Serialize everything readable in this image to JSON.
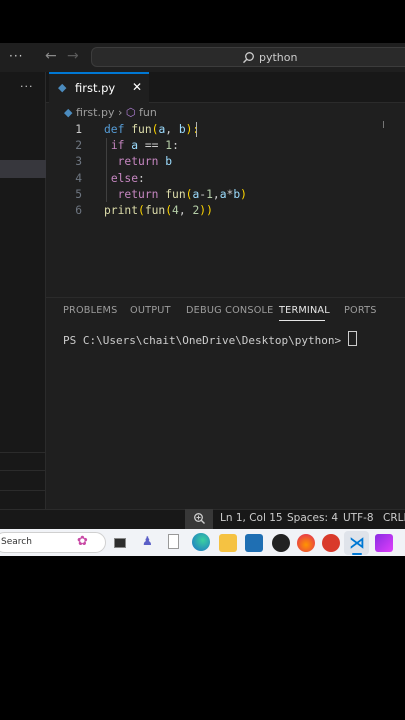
{
  "titlebar": {
    "more_label": "···",
    "search_text": "python"
  },
  "sidebar": {
    "more_label": "···"
  },
  "tab": {
    "filename": "first.py",
    "close_glyph": "✕"
  },
  "breadcrumb": {
    "file": "first.py",
    "separator": "›",
    "symbol": "fun"
  },
  "code": [
    {
      "n": "1",
      "text": "def fun(a, b):"
    },
    {
      "n": "2",
      "text": " if a == 1:"
    },
    {
      "n": "3",
      "text": "  return b"
    },
    {
      "n": "4",
      "text": " else:"
    },
    {
      "n": "5",
      "text": "  return fun(a-1,a*b)"
    },
    {
      "n": "6",
      "text": "print(fun(4, 2))"
    }
  ],
  "panel": {
    "tabs": [
      "PROBLEMS",
      "OUTPUT",
      "DEBUG CONSOLE",
      "TERMINAL",
      "PORTS"
    ],
    "active": "TERMINAL",
    "prompt": "PS C:\\Users\\chait\\OneDrive\\Desktop\\python> "
  },
  "status": {
    "position": "Ln 1, Col 15",
    "spaces": "Spaces: 4",
    "encoding": "UTF-8",
    "eol": "CRLF"
  },
  "taskbar": {
    "search": "Search"
  },
  "colors": {
    "keyword": "#569cd6",
    "control": "#c586c0",
    "function": "#dcdcaa",
    "param": "#9cdcfe",
    "number": "#b5cea8",
    "accent": "#0078d4"
  }
}
